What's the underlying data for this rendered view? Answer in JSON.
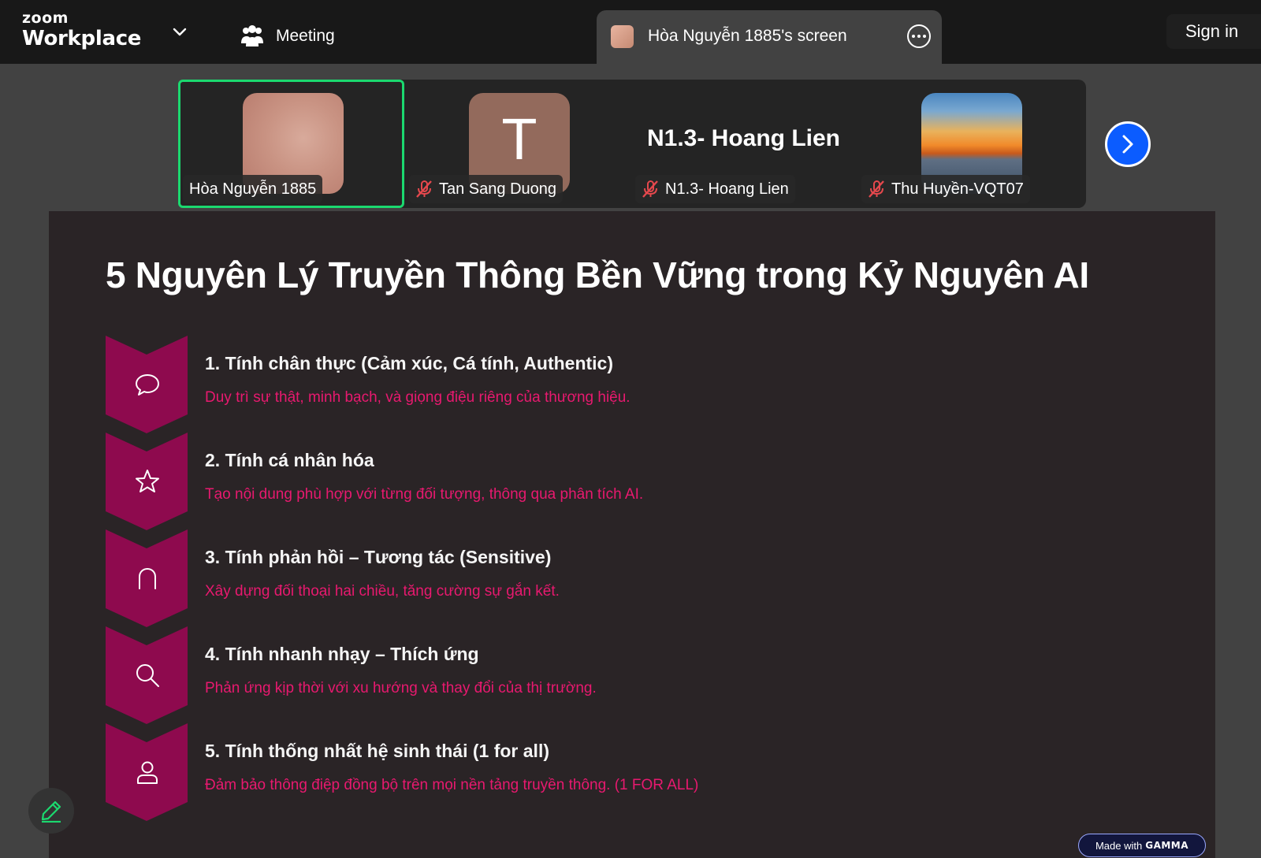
{
  "topbar": {
    "logo_small": "zoom",
    "logo_main": "Workplace",
    "meeting_label": "Meeting",
    "screen_tab_label": "Hòa Nguyễn 1885's screen",
    "signin_label": "Sign in"
  },
  "gallery": {
    "participants": [
      {
        "name": "Hòa Nguyễn 1885",
        "avatar": "photo"
      },
      {
        "name": "Tan Sang Duong",
        "avatar": "letter",
        "letter": "T"
      },
      {
        "name": "N1.3- Hoang Lien",
        "avatar": "name-only",
        "display_name": "N1.3- Hoang Lien"
      },
      {
        "name": "Thu Huyền-VQT07",
        "avatar": "sunset"
      }
    ]
  },
  "slide": {
    "title": "5 Nguyên Lý Truyền Thông Bền Vững trong Kỷ Nguyên AI",
    "items": [
      {
        "title": "1. Tính chân thực (Cảm xúc, Cá tính, Authentic)",
        "desc": "Duy trì sự thật, minh bạch, và giọng điệu riêng của thương hiệu.",
        "icon": "speech-bubble-icon"
      },
      {
        "title": "2. Tính cá nhân hóa",
        "desc": "Tạo nội dung phù hợp với từng đối tượng, thông qua phân tích AI.",
        "icon": "star-icon"
      },
      {
        "title": "3. Tính phản hồi – Tương tác (Sensitive)",
        "desc": "Xây dựng đối thoại hai chiều, tăng cường sự gắn kết.",
        "icon": "arch-icon"
      },
      {
        "title": "4. Tính nhanh nhạy – Thích ứng",
        "desc": "Phản ứng kịp thời với xu hướng và thay đổi của thị trường.",
        "icon": "search-icon"
      },
      {
        "title": "5. Tính thống nhất hệ sinh thái (1 for all)",
        "desc": "Đảm bảo thông điệp đồng bộ trên mọi nền tảng truyền thông. (1 FOR ALL)",
        "icon": "person-icon"
      }
    ],
    "badge_prefix": "Made with",
    "badge_brand": "GAMMA"
  },
  "colors": {
    "accent_magenta": "#8e0a4e",
    "desc_pink": "#e8196f",
    "active_green": "#1bd96f",
    "zoom_blue": "#0b5cff"
  }
}
